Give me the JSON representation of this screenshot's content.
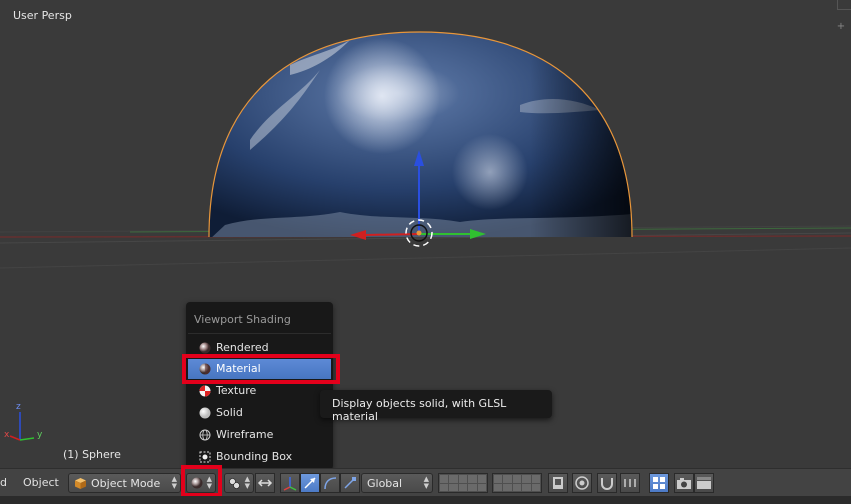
{
  "viewport": {
    "view_label": "User Persp",
    "object_label": "(1) Sphere",
    "axis_x": "x",
    "axis_y": "y",
    "axis_z": "z"
  },
  "shading_menu": {
    "title": "Viewport Shading",
    "items": [
      {
        "label": "Rendered",
        "icon": "rendered-sphere-icon"
      },
      {
        "label": "Material",
        "icon": "material-sphere-icon",
        "active": true
      },
      {
        "label": "Texture",
        "icon": "texture-checker-icon"
      },
      {
        "label": "Solid",
        "icon": "solid-sphere-icon"
      },
      {
        "label": "Wireframe",
        "icon": "wireframe-sphere-icon"
      },
      {
        "label": "Bounding Box",
        "icon": "bounding-box-icon"
      }
    ]
  },
  "tooltip": {
    "text": "Display objects solid, with GLSL material"
  },
  "header": {
    "menu_partial": "d",
    "object_menu": "Object",
    "mode": "Object Mode",
    "orientation": "Global"
  },
  "colors": {
    "accent_blue": "#5680c2",
    "highlight_red": "#e3001b",
    "selection_orange": "#e8963a"
  }
}
